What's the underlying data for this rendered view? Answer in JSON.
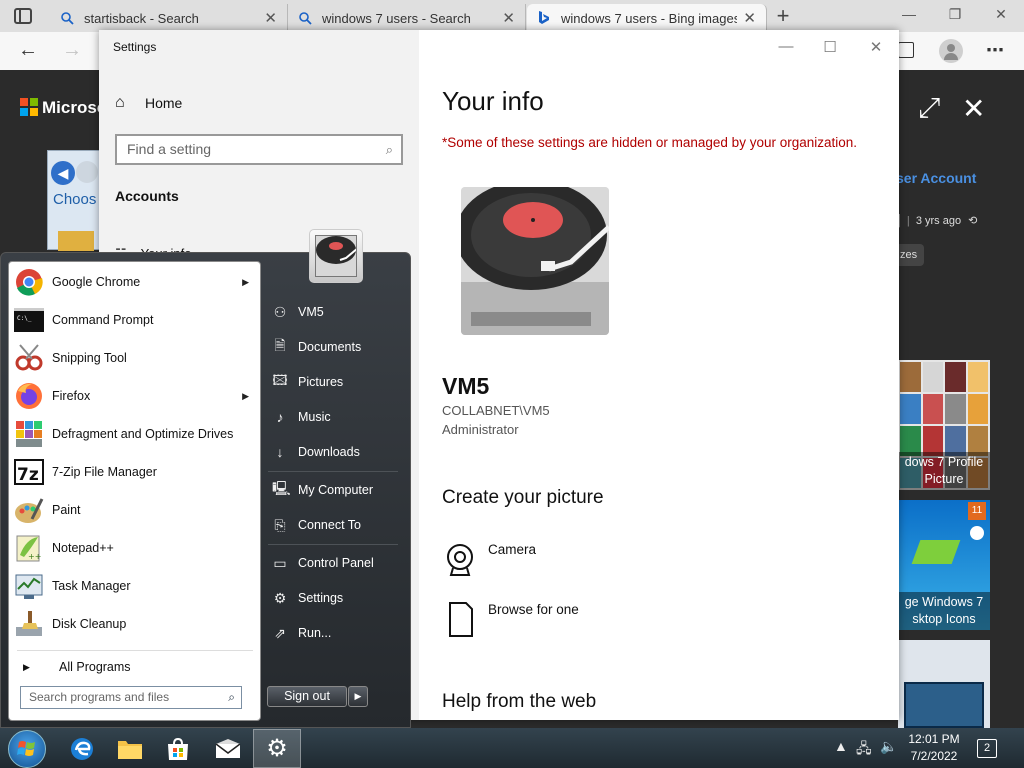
{
  "browser": {
    "tabs": [
      {
        "title": "startisback - Search",
        "icon": "search-icon"
      },
      {
        "title": "windows 7 users - Search",
        "icon": "search-icon"
      },
      {
        "title": "windows 7 users - Bing images",
        "icon": "bing-icon"
      }
    ],
    "new_tab_label": "+",
    "bing_brand": "Microsoft"
  },
  "bing": {
    "card_title": "ser Account",
    "card_meta": "3 yrs ago",
    "card_pill": "zes",
    "old_thumb_text": "Choos",
    "thumbs": [
      {
        "caption": "dows 7 Profile Picture"
      },
      {
        "caption": "ge Windows 7 sktop Icons"
      },
      {
        "caption": ""
      }
    ],
    "date_badge": "11"
  },
  "settings": {
    "window_title": "Settings",
    "home_label": "Home",
    "search_placeholder": "Find a setting",
    "section_label": "Accounts",
    "hidden_item_label": "Your info",
    "page_title": "Your info",
    "org_warning": "*Some of these settings are hidden or managed by your organization.",
    "user_name": "VM5",
    "user_domain": "COLLABNET\\VM5",
    "user_role": "Administrator",
    "create_heading": "Create your picture",
    "option_camera": "Camera",
    "option_browse": "Browse for one",
    "help_heading": "Help from the web"
  },
  "start_menu": {
    "programs": [
      {
        "label": "Google Chrome",
        "icon": "chrome-icon",
        "submenu": true
      },
      {
        "label": "Command Prompt",
        "icon": "cmd-icon",
        "submenu": false
      },
      {
        "label": "Snipping Tool",
        "icon": "scissors-icon",
        "submenu": false
      },
      {
        "label": "Firefox",
        "icon": "firefox-icon",
        "submenu": true
      },
      {
        "label": "Defragment and Optimize Drives",
        "icon": "defrag-icon",
        "submenu": false
      },
      {
        "label": "7-Zip File Manager",
        "icon": "7zip-icon",
        "submenu": false
      },
      {
        "label": "Paint",
        "icon": "paint-icon",
        "submenu": false
      },
      {
        "label": "Notepad++",
        "icon": "notepadpp-icon",
        "submenu": false
      },
      {
        "label": "Task Manager",
        "icon": "task-manager-icon",
        "submenu": false
      },
      {
        "label": "Disk Cleanup",
        "icon": "disk-cleanup-icon",
        "submenu": false
      }
    ],
    "all_programs": "All Programs",
    "search_placeholder": "Search programs and files",
    "right_items": [
      {
        "label": "VM5",
        "icon": "user-icon"
      },
      {
        "label": "Documents",
        "icon": "documents-icon"
      },
      {
        "label": "Pictures",
        "icon": "pictures-icon"
      },
      {
        "label": "Music",
        "icon": "music-icon"
      },
      {
        "label": "Downloads",
        "icon": "downloads-icon"
      },
      {
        "label": "My Computer",
        "icon": "computer-icon"
      },
      {
        "label": "Connect To",
        "icon": "connect-icon"
      },
      {
        "label": "Control Panel",
        "icon": "control-panel-icon"
      },
      {
        "label": "Settings",
        "icon": "gear-icon"
      },
      {
        "label": "Run...",
        "icon": "run-icon"
      }
    ],
    "sign_out": "Sign out"
  },
  "taskbar": {
    "time": "12:01 PM",
    "date": "7/2/2022",
    "notification_count": "2",
    "pinned": [
      "edge-icon",
      "file-explorer-icon",
      "store-icon",
      "mail-icon",
      "settings-icon"
    ]
  },
  "colors": {
    "warning_red": "#b00000",
    "bing_accent": "#4a90e2",
    "start_menu_dark": "#2b3035"
  }
}
